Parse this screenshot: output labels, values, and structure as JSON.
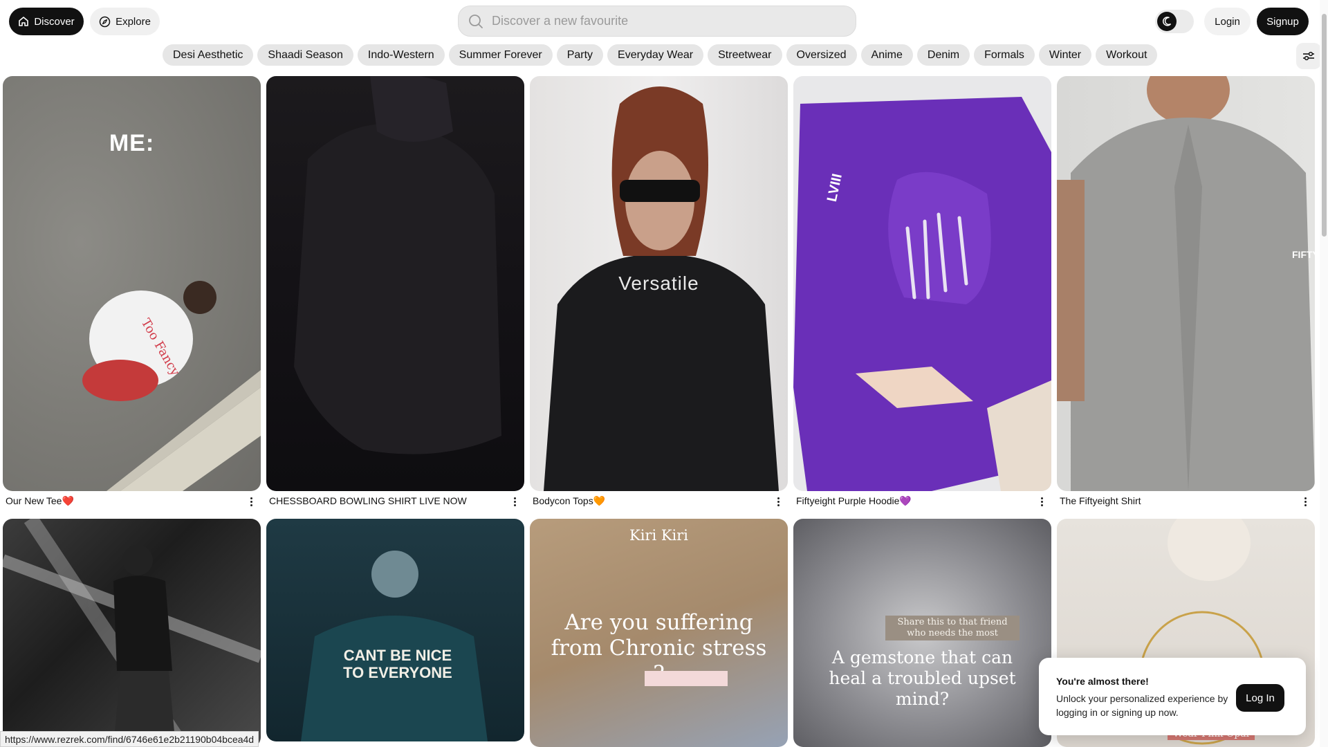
{
  "header": {
    "discover_label": "Discover",
    "explore_label": "Explore",
    "search_placeholder": "Discover a new favourite",
    "login_label": "Login",
    "signup_label": "Signup"
  },
  "categories": [
    "Desi Aesthetic",
    "Shaadi Season",
    "Indo-Western",
    "Summer Forever",
    "Party",
    "Everyday Wear",
    "Streetwear",
    "Oversized",
    "Anime",
    "Denim",
    "Formals",
    "Winter",
    "Workout"
  ],
  "cards_row1": [
    {
      "caption": "Our New Tee❤️",
      "overlay": "ME:"
    },
    {
      "caption": "CHESSBOARD BOWLING SHIRT LIVE NOW"
    },
    {
      "caption": "Bodycon Tops🧡",
      "overlay": "Versatile"
    },
    {
      "caption": "Fiftyeight Purple Hoodie💜",
      "overlay": "LVIII"
    },
    {
      "caption": "The Fiftyeight Shirt",
      "overlay": "FIFTY"
    }
  ],
  "cards_row2": [
    {
      "overlay": ""
    },
    {
      "overlay": "CANT BE NICE TO EVERYONE"
    },
    {
      "overlay_top": "Kiri Kiri",
      "overlay": "Are you suffering from Chronic stress ?"
    },
    {
      "overlay_top": "Share this to that friend who needs the most",
      "overlay": "A gemstone that can heal a troubled upset mind?"
    },
    {
      "overlay": "Wear Pink Opal"
    }
  ],
  "popup": {
    "title": "You're almost there!",
    "message": "Unlock your personalized experience by logging in or signing up now.",
    "button": "Log In"
  },
  "status_url": "https://www.rezrek.com/find/6746e61e2b21190b04bcea4d",
  "colors": {
    "primary": "#111111",
    "chip_bg": "#e6e6e6",
    "hoodie_purple": "#6a2fb8"
  }
}
